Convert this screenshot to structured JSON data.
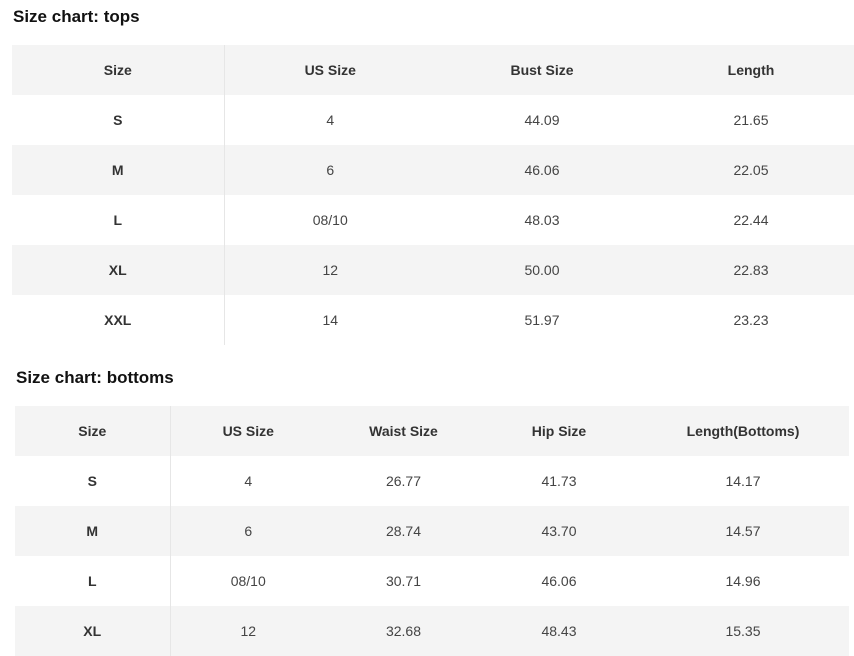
{
  "tops": {
    "title": "Size chart: tops",
    "headers": [
      "Size",
      "US Size",
      "Bust Size",
      "Length"
    ],
    "rows": [
      [
        "S",
        "4",
        "44.09",
        "21.65"
      ],
      [
        "M",
        "6",
        "46.06",
        "22.05"
      ],
      [
        "L",
        "08/10",
        "48.03",
        "22.44"
      ],
      [
        "XL",
        "12",
        "50.00",
        "22.83"
      ],
      [
        "XXL",
        "14",
        "51.97",
        "23.23"
      ]
    ]
  },
  "bottoms": {
    "title": "Size chart: bottoms",
    "headers": [
      "Size",
      "US Size",
      "Waist Size",
      "Hip Size",
      "Length(Bottoms)"
    ],
    "rows": [
      [
        "S",
        "4",
        "26.77",
        "41.73",
        "14.17"
      ],
      [
        "M",
        "6",
        "28.74",
        "43.70",
        "14.57"
      ],
      [
        "L",
        "08/10",
        "30.71",
        "46.06",
        "14.96"
      ],
      [
        "XL",
        "12",
        "32.68",
        "48.43",
        "15.35"
      ]
    ]
  },
  "colors": {
    "shaded_row": "#f4f4f4",
    "divider": "#e6e6e6",
    "text": "#333333"
  }
}
